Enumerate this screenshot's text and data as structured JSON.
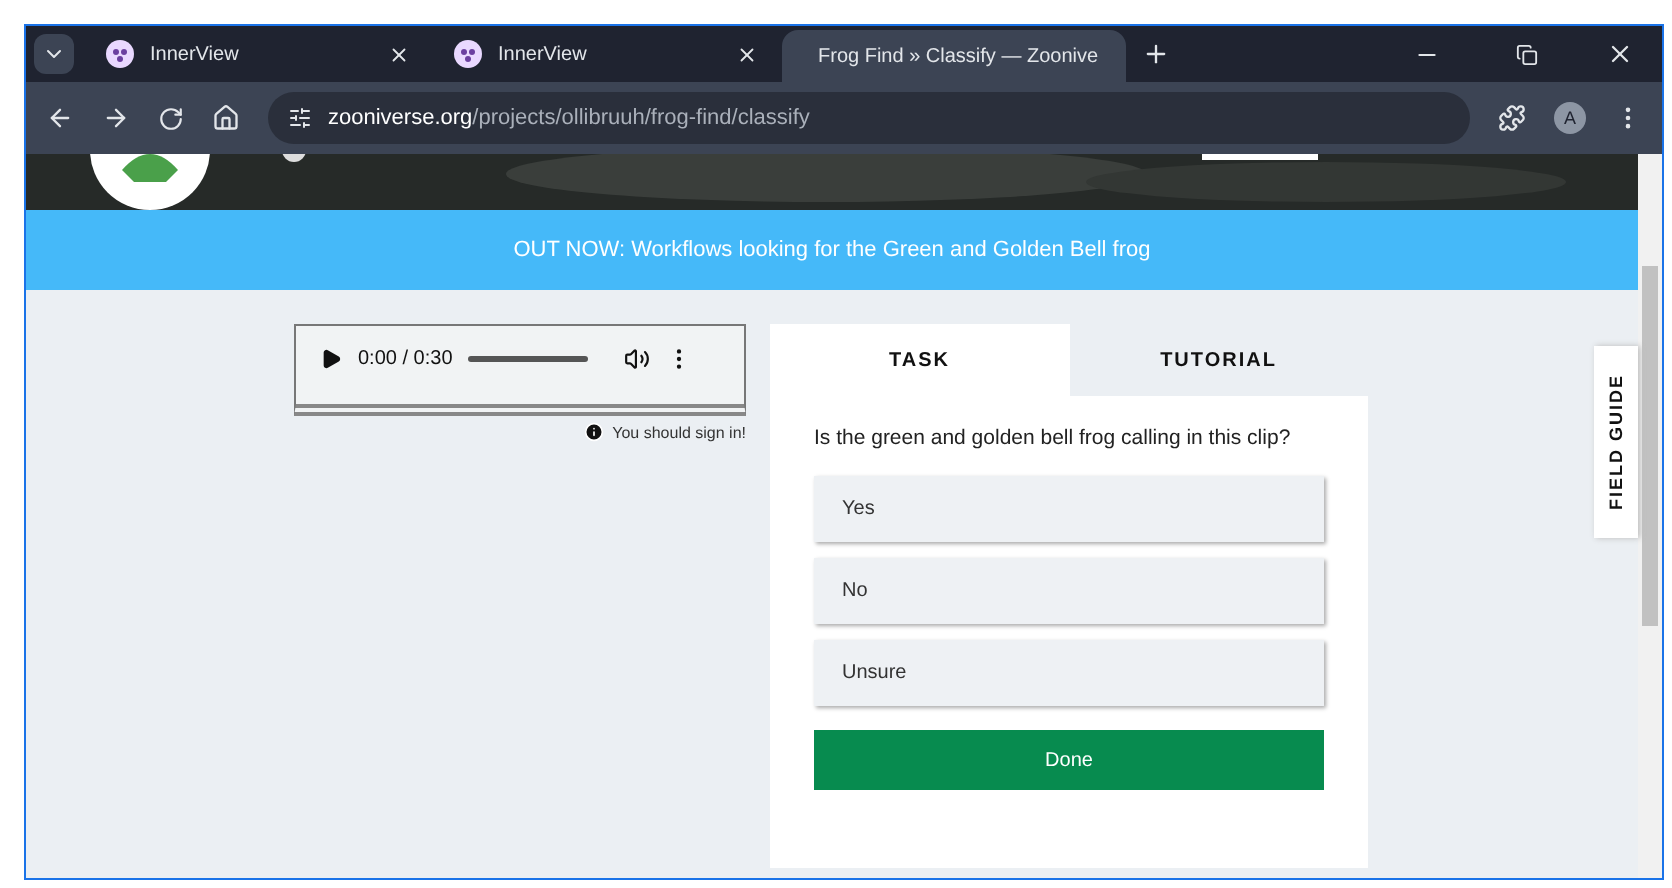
{
  "browser": {
    "tabs": [
      {
        "title": "InnerView",
        "selected": false
      },
      {
        "title": "InnerView",
        "selected": false
      },
      {
        "title": "Frog Find » Classify — Zoonive",
        "selected": true
      }
    ],
    "url": {
      "host": "zooniverse.org",
      "path": "/projects/ollibruuh/frog-find/classify"
    },
    "profile_initial": "A"
  },
  "banner": "OUT NOW: Workflows looking for the Green and Golden Bell frog",
  "audio": {
    "time": "0:00 / 0:30"
  },
  "sign_in_note": "You should sign in!",
  "task_tabs": [
    {
      "label": "TASK",
      "selected": true
    },
    {
      "label": "TUTORIAL",
      "selected": false
    }
  ],
  "question": "Is the green and golden bell frog calling in this clip?",
  "answers": [
    {
      "label": "Yes",
      "selected": false
    },
    {
      "label": "No",
      "selected": false
    },
    {
      "label": "Unsure",
      "selected": false
    }
  ],
  "done_button": "Done",
  "field_guide": "FIELD GUIDE"
}
